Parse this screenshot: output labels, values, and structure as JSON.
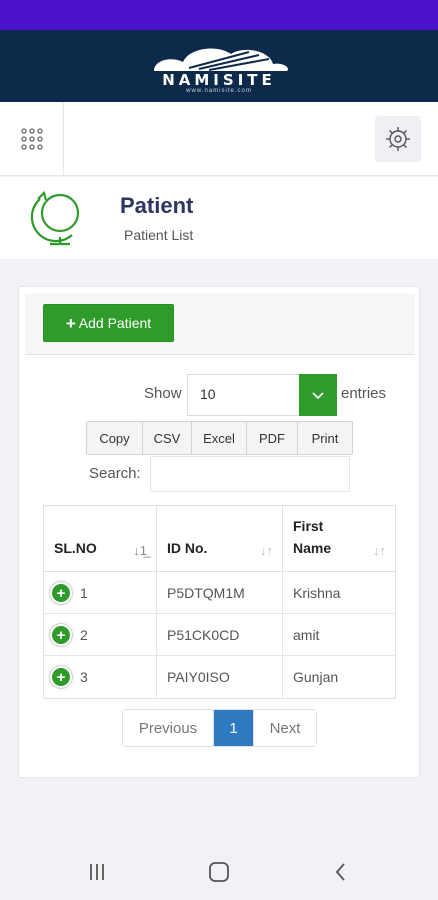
{
  "brand": {
    "name": "NAMISITE",
    "subtitle": "www.namisite.com"
  },
  "toolbar": {
    "menu_icon": "grid-icon",
    "settings_icon": "gear-icon"
  },
  "page": {
    "icon": "globe-icon",
    "title": "Patient",
    "subtitle": "Patient List"
  },
  "actions": {
    "add_label": "Add Patient",
    "add_icon": "plus-icon"
  },
  "entries": {
    "show_label": "Show",
    "value": "10",
    "suffix_label": "entries"
  },
  "export_buttons": [
    "Copy",
    "CSV",
    "Excel",
    "PDF",
    "Print"
  ],
  "search": {
    "label": "Search:",
    "value": ""
  },
  "table": {
    "columns": [
      {
        "label": "SL.NO",
        "sort_icon": "sort-numeric-icon"
      },
      {
        "label": "ID No.",
        "sort_icon": "sort-icon"
      },
      {
        "label": "First\nName",
        "sort_icon": "sort-icon"
      }
    ],
    "rows": [
      {
        "sl_no": "1",
        "id_no": "P5DTQM1M",
        "first_name": "Krishna"
      },
      {
        "sl_no": "2",
        "id_no": "P51CK0CD",
        "first_name": "amit"
      },
      {
        "sl_no": "3",
        "id_no": "PAIY0ISO",
        "first_name": "Gunjan"
      }
    ]
  },
  "pagination": {
    "previous_label": "Previous",
    "current_page": "1",
    "next_label": "Next"
  },
  "colors": {
    "status_bar": "#4a12c8",
    "brand_bar": "#0e2a4a",
    "accent_green": "#2e9b2a",
    "active_page": "#2f79c0",
    "title": "#2d3561"
  },
  "nav": {
    "recents_icon": "recents-icon",
    "home_icon": "home-icon",
    "back_icon": "back-icon"
  }
}
